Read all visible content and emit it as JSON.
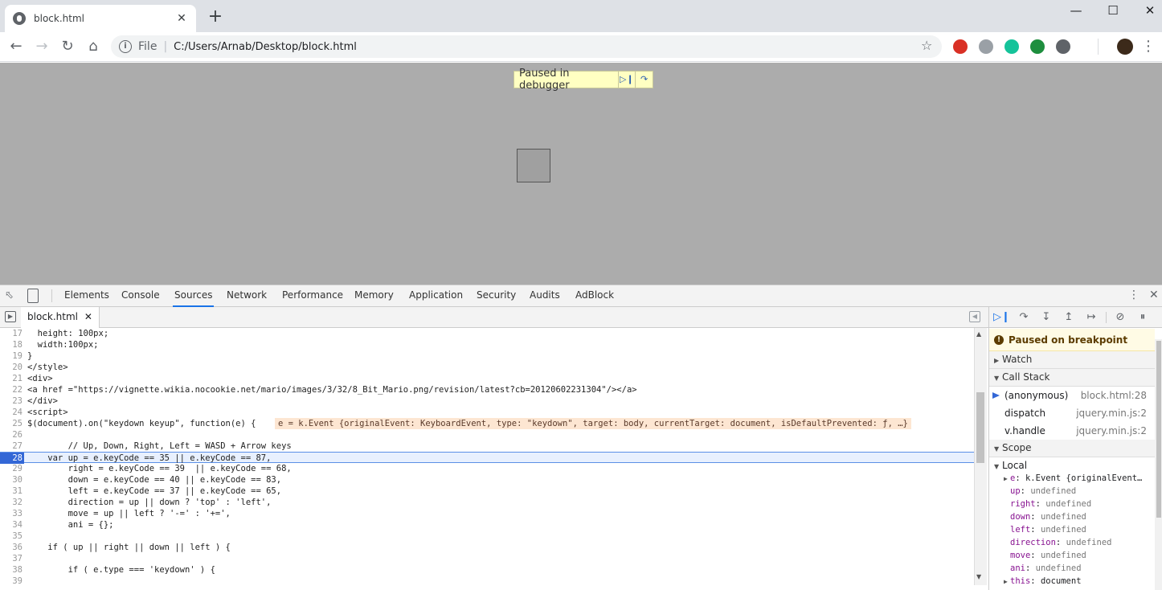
{
  "browser": {
    "tab_title": "block.html",
    "new_tab": "+",
    "url_scheme": "File",
    "url": "C:/Users/Arnab/Desktop/block.html"
  },
  "page": {
    "paused_message": "Paused in debugger"
  },
  "devtools": {
    "tabs": [
      "Elements",
      "Console",
      "Sources",
      "Network",
      "Performance",
      "Memory",
      "Application",
      "Security",
      "Audits",
      "AdBlock"
    ],
    "active_tab": "Sources",
    "open_file": "block.html"
  },
  "code": {
    "lines": [
      {
        "n": "17",
        "t": "  height: 100px;"
      },
      {
        "n": "18",
        "t": "  width:100px;"
      },
      {
        "n": "19",
        "t": "}"
      },
      {
        "n": "20",
        "t": "</style>"
      },
      {
        "n": "21",
        "t": "<div>"
      },
      {
        "n": "22",
        "t": "<a href =\"https://vignette.wikia.nocookie.net/mario/images/3/32/8_Bit_Mario.png/revision/latest?cb=20120602231304\"/></a>"
      },
      {
        "n": "23",
        "t": "</div>"
      },
      {
        "n": "24",
        "t": "<script>"
      },
      {
        "n": "25",
        "t": "$(document).on(\"keydown keyup\", function(e) {"
      },
      {
        "n": "26",
        "t": ""
      },
      {
        "n": "27",
        "t": "        // Up, Down, Right, Left = WASD + Arrow keys"
      },
      {
        "n": "28",
        "t": "    var up = e.keyCode == 35 || e.keyCode == 87,"
      },
      {
        "n": "29",
        "t": "        right = e.keyCode == 39  || e.keyCode == 68,"
      },
      {
        "n": "30",
        "t": "        down = e.keyCode == 40 || e.keyCode == 83,"
      },
      {
        "n": "31",
        "t": "        left = e.keyCode == 37 || e.keyCode == 65,"
      },
      {
        "n": "32",
        "t": "        direction = up || down ? 'top' : 'left',"
      },
      {
        "n": "33",
        "t": "        move = up || left ? '-=' : '+=',"
      },
      {
        "n": "34",
        "t": "        ani = {};"
      },
      {
        "n": "35",
        "t": ""
      },
      {
        "n": "36",
        "t": "    if ( up || right || down || left ) {"
      },
      {
        "n": "37",
        "t": ""
      },
      {
        "n": "38",
        "t": "        if ( e.type === 'keydown' ) {"
      },
      {
        "n": "39",
        "t": ""
      }
    ],
    "current_line": "28",
    "inline_value": "e = k.Event {originalEvent: KeyboardEvent, type: \"keydown\", target: body, currentTarget: document, isDefaultPrevented: ƒ, …}"
  },
  "debugger": {
    "paused_status": "Paused on breakpoint",
    "watch_label": "Watch",
    "callstack_label": "Call Stack",
    "frames": [
      {
        "fn": "(anonymous)",
        "loc": "block.html:28"
      },
      {
        "fn": "dispatch",
        "loc": "jquery.min.js:2"
      },
      {
        "fn": "v.handle",
        "loc": "jquery.min.js:2"
      }
    ],
    "scope_label": "Scope",
    "local_label": "Local",
    "vars": [
      {
        "k": "e",
        "v": "k.Event {originalEvent…"
      },
      {
        "k": "up",
        "v": "undefined"
      },
      {
        "k": "right",
        "v": "undefined"
      },
      {
        "k": "down",
        "v": "undefined"
      },
      {
        "k": "left",
        "v": "undefined"
      },
      {
        "k": "direction",
        "v": "undefined"
      },
      {
        "k": "move",
        "v": "undefined"
      },
      {
        "k": "ani",
        "v": "undefined"
      },
      {
        "k": "this",
        "v": "document"
      }
    ]
  }
}
